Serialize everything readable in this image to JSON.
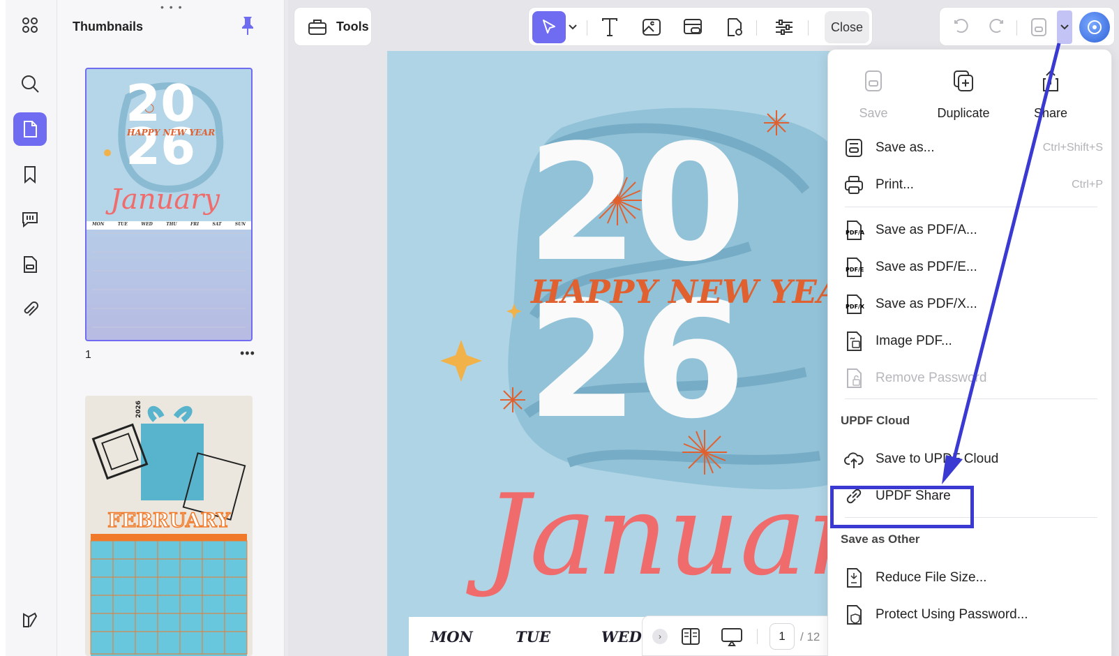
{
  "thumbnails": {
    "title": "Thumbnails",
    "page1_number": "1",
    "thumb1": {
      "year_top": "20",
      "year_bottom": "26",
      "greeting": "HAPPY NEW YEAR",
      "month": "January"
    },
    "thumb2": {
      "year": "2026",
      "month": "FEBRUARY"
    },
    "weekdays": [
      "MON",
      "TUE",
      "WED",
      "THU",
      "FRI",
      "SAT",
      "SUN"
    ]
  },
  "toolbar": {
    "tools_label": "Tools",
    "close_label": "Close"
  },
  "document": {
    "year_top": "20",
    "year_bottom": "26",
    "greeting": "HAPPY NEW YEAR",
    "month": "January",
    "weekdays": [
      "MON",
      "TUE",
      "WED"
    ]
  },
  "pager": {
    "current_page": "1",
    "total": "/ 12"
  },
  "menu": {
    "quick_actions": [
      {
        "label": "Save",
        "icon": "save-icon",
        "disabled": true
      },
      {
        "label": "Duplicate",
        "icon": "duplicate-icon",
        "disabled": false
      },
      {
        "label": "Share",
        "icon": "share-icon",
        "disabled": false
      }
    ],
    "items": [
      {
        "label": "Save as...",
        "shortcut": "Ctrl+Shift+S",
        "icon": "save-as-icon"
      },
      {
        "label": "Print...",
        "shortcut": "Ctrl+P",
        "icon": "print-icon"
      },
      {
        "label": "Save as PDF/A...",
        "icon": "pdf-a-icon",
        "badge": "PDF/A"
      },
      {
        "label": "Save as PDF/E...",
        "icon": "pdf-e-icon",
        "badge": "PDF/E"
      },
      {
        "label": "Save as PDF/X...",
        "icon": "pdf-x-icon",
        "badge": "PDF/X"
      },
      {
        "label": "Image PDF...",
        "icon": "image-pdf-icon"
      },
      {
        "label": "Remove Password",
        "icon": "remove-password-icon",
        "disabled": true
      }
    ],
    "cloud_section": "UPDF Cloud",
    "cloud_items": [
      {
        "label": "Save to UPDF Cloud",
        "icon": "cloud-upload-icon"
      },
      {
        "label": "UPDF Share",
        "icon": "link-icon"
      }
    ],
    "other_section": "Save as Other",
    "other_items": [
      {
        "label": "Reduce File Size...",
        "icon": "reduce-size-icon"
      },
      {
        "label": "Protect Using Password...",
        "icon": "protect-icon"
      }
    ]
  },
  "colors": {
    "accent": "#6f6cf2",
    "annotation": "#3a3ad2",
    "doc_bg": "#afd4e5",
    "orange": "#e0612f",
    "coral": "#f06c6c"
  }
}
